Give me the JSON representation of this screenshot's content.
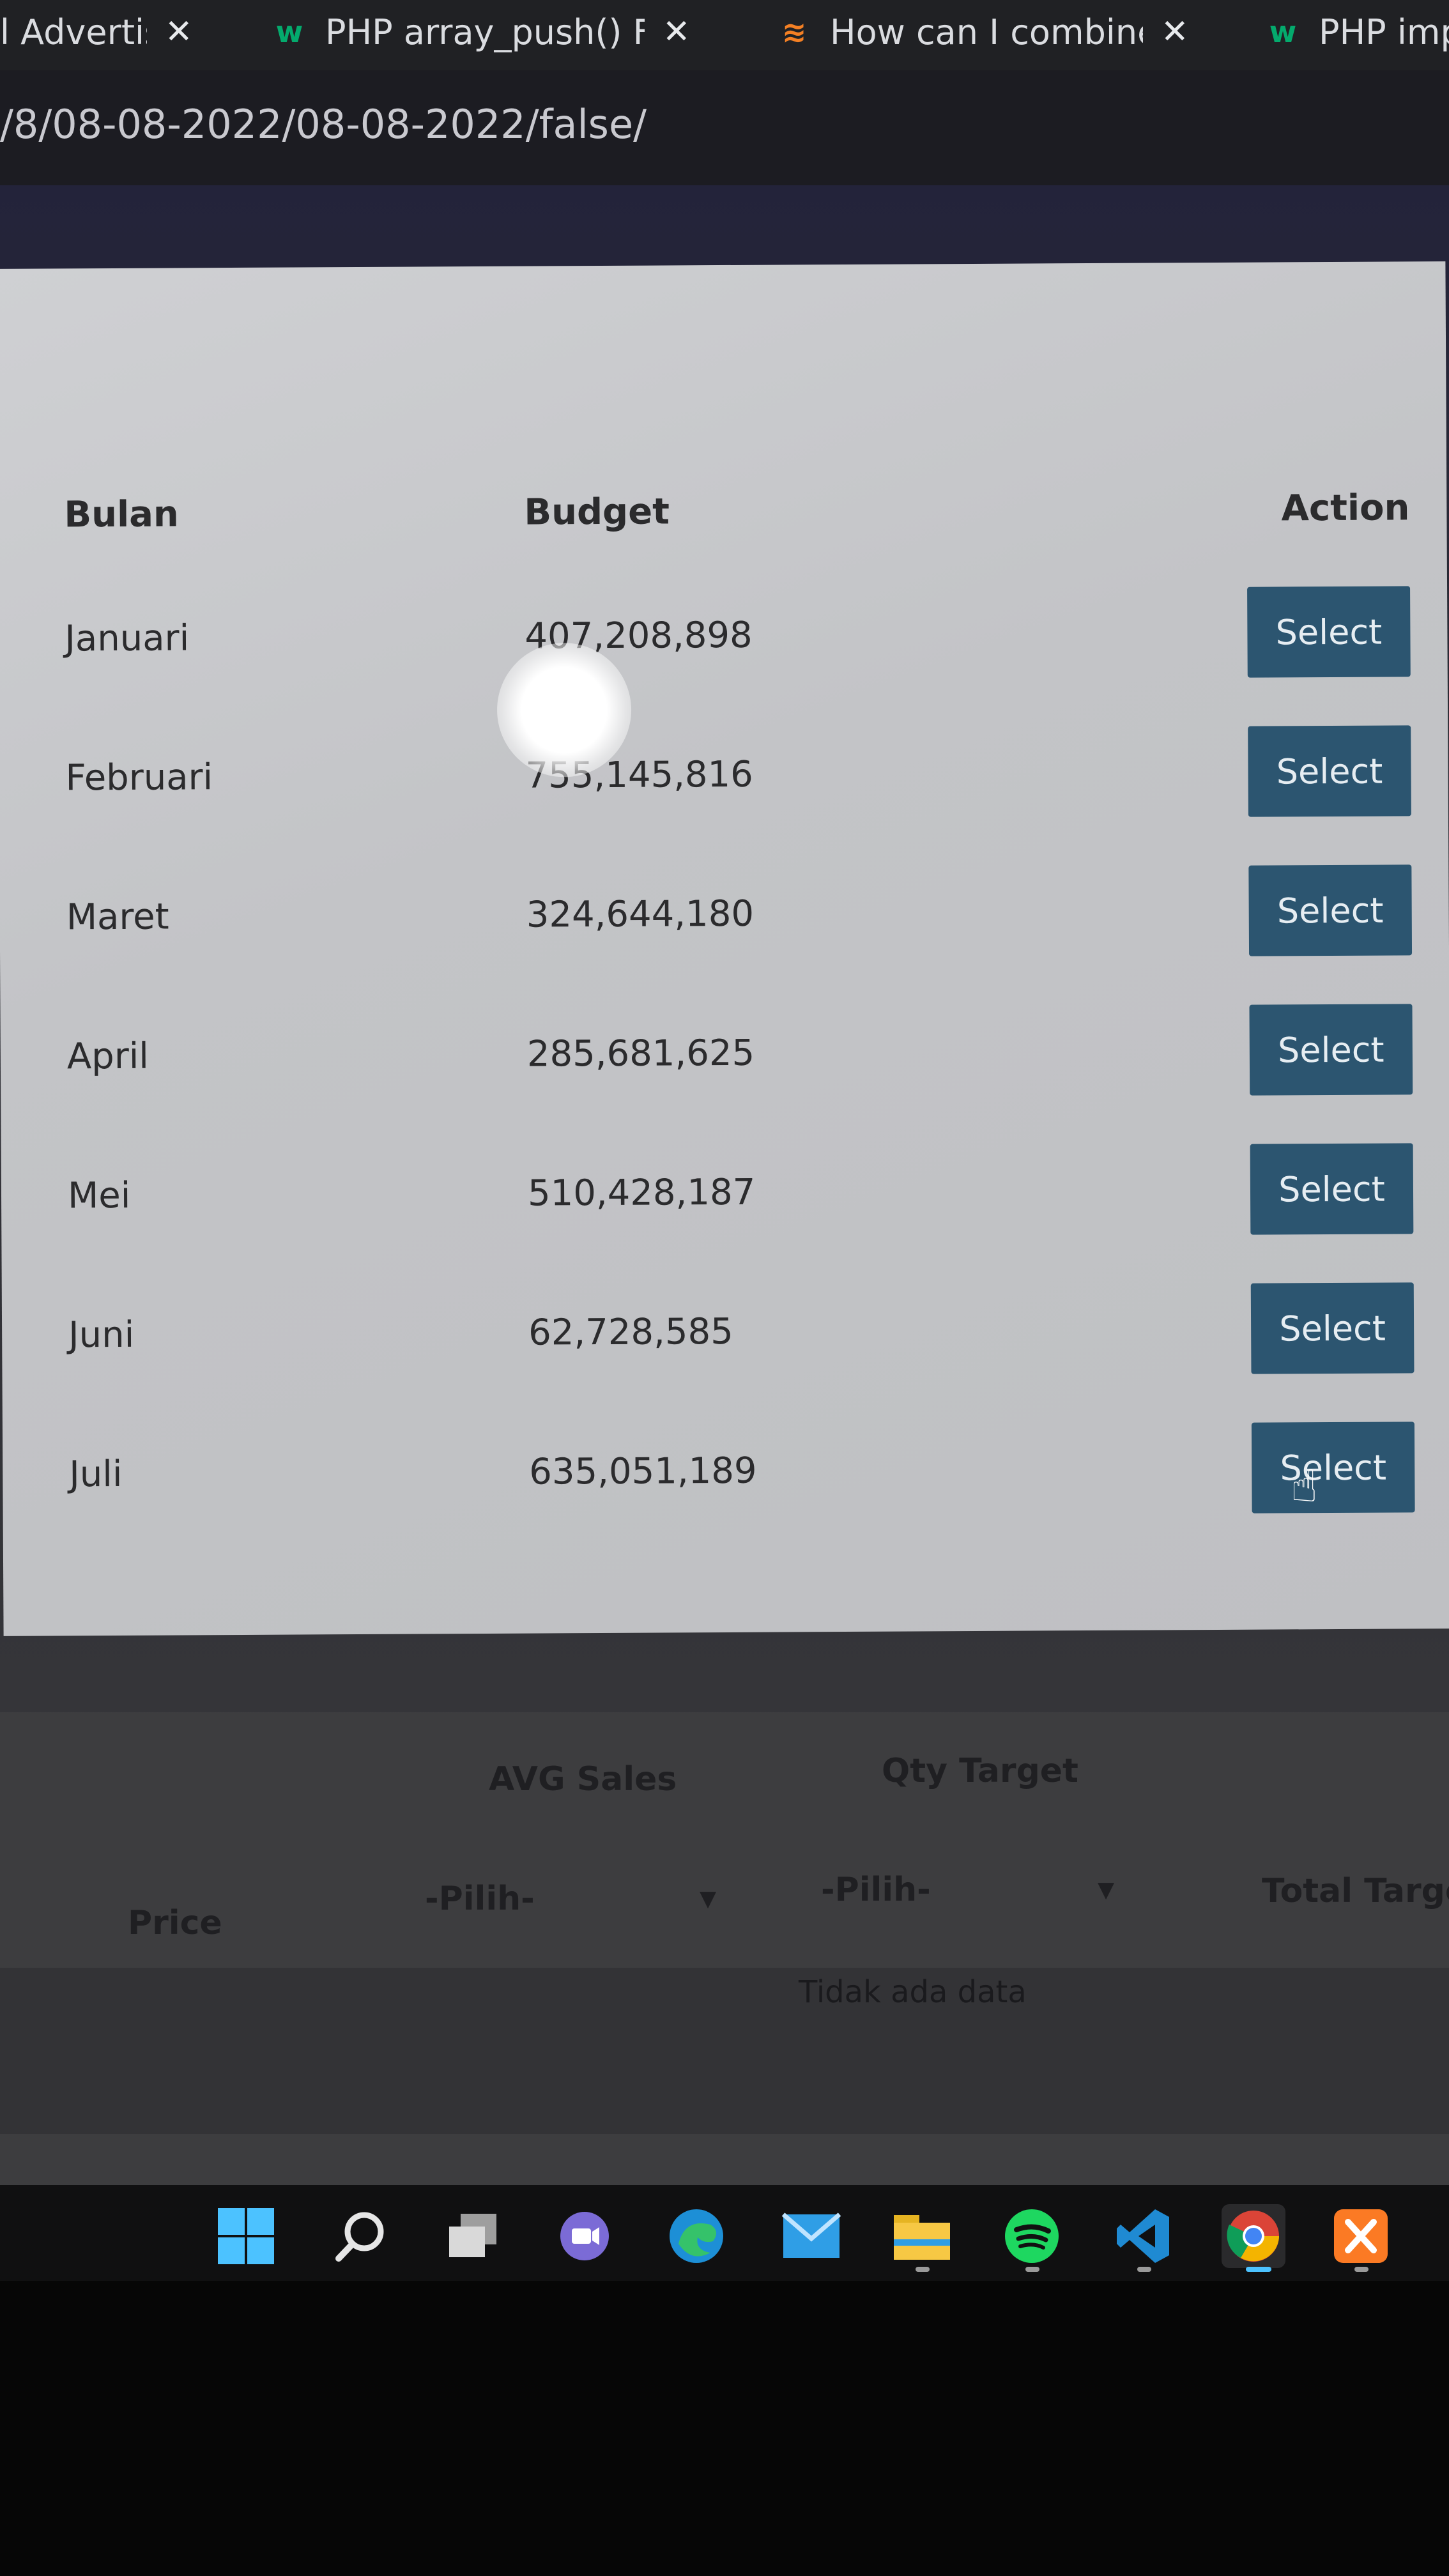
{
  "browser": {
    "tabs": [
      {
        "title": "l Advertisi",
        "favicon": "page-icon"
      },
      {
        "title": "PHP array_push() Fun",
        "favicon": "w3schools-icon"
      },
      {
        "title": "How can I combine t",
        "favicon": "stackoverflow-icon"
      },
      {
        "title": "PHP imp",
        "favicon": "w3schools-icon"
      }
    ],
    "close_glyph": "✕",
    "url": "/8/08-08-2022/08-08-2022/false/"
  },
  "modal": {
    "columns": {
      "bulan": "Bulan",
      "target": "Budget",
      "action": "Action"
    },
    "rows": [
      {
        "bulan": "Januari",
        "target": "407,208,898",
        "action": "Select"
      },
      {
        "bulan": "Februari",
        "target": "755,145,816",
        "action": "Select"
      },
      {
        "bulan": "Maret",
        "target": "324,644,180",
        "action": "Select"
      },
      {
        "bulan": "April",
        "target": "285,681,625",
        "action": "Select"
      },
      {
        "bulan": "Mei",
        "target": "510,428,187",
        "action": "Select"
      },
      {
        "bulan": "Juni",
        "target": "62,728,585",
        "action": "Select"
      },
      {
        "bulan": "Juli",
        "target": "635,051,189",
        "action": "Select"
      }
    ]
  },
  "form_behind": {
    "avg_sales_label": "AVG Sales",
    "qty_target_label": "Qty Target",
    "price_label": "Price",
    "total_target_label": "Total Target",
    "avg_select_value": "-Pilih-",
    "qty_select_value": "-Pilih-",
    "empty_text": "Tidak ada data"
  },
  "taskbar": {
    "icons": [
      "windows-start-icon",
      "search-icon",
      "task-view-icon",
      "teams-chat-icon",
      "edge-icon",
      "mail-icon",
      "file-explorer-icon",
      "spotify-icon",
      "vscode-icon",
      "chrome-icon",
      "xampp-icon"
    ]
  },
  "colors": {
    "select_button": "#2c5570",
    "modal_bg": "#c6c7ca",
    "taskbar": "#101011"
  }
}
